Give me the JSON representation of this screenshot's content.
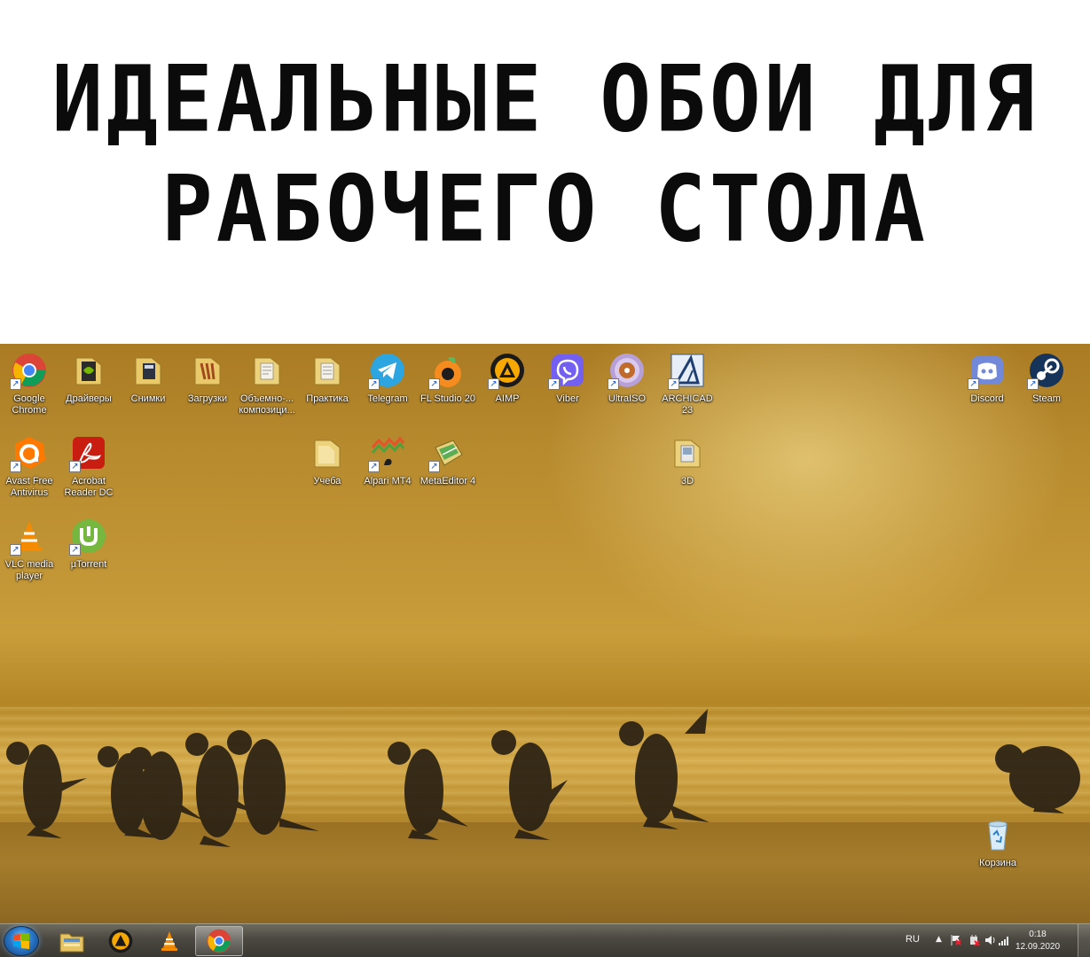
{
  "caption": {
    "line1": "ИДЕАЛЬНЫЕ ОБОИ ДЛЯ",
    "line2": "РАБОЧЕГО СТОЛА"
  },
  "desktop_icons": [
    {
      "label": "Google Chrome",
      "icon": "chrome-icon"
    },
    {
      "label": "Драйверы",
      "icon": "folder-icon"
    },
    {
      "label": "Снимки",
      "icon": "folder-icon"
    },
    {
      "label": "Загрузки",
      "icon": "folder-icon"
    },
    {
      "label": "Объемно-... композици...",
      "icon": "folder-icon"
    },
    {
      "label": "Практика",
      "icon": "folder-icon"
    },
    {
      "label": "Telegram",
      "icon": "telegram-icon"
    },
    {
      "label": "FL Studio 20",
      "icon": "fl-studio-icon"
    },
    {
      "label": "AIMP",
      "icon": "aimp-icon"
    },
    {
      "label": "Viber",
      "icon": "viber-icon"
    },
    {
      "label": "UltraISO",
      "icon": "ultraiso-icon"
    },
    {
      "label": "ARCHICAD 23",
      "icon": "archicad-icon"
    },
    {
      "label": "Discord",
      "icon": "discord-icon"
    },
    {
      "label": "Steam",
      "icon": "steam-icon"
    },
    {
      "label": "Avast Free Antivirus",
      "icon": "avast-icon"
    },
    {
      "label": "Acrobat Reader DC",
      "icon": "acrobat-icon"
    },
    {
      "label": "Учеба",
      "icon": "folder-icon"
    },
    {
      "label": "Alpari MT4",
      "icon": "alpari-icon"
    },
    {
      "label": "MetaEditor 4",
      "icon": "metaeditor-icon"
    },
    {
      "label": "3D",
      "icon": "folder-icon"
    },
    {
      "label": "VLC media player",
      "icon": "vlc-icon"
    },
    {
      "label": "µTorrent",
      "icon": "utorrent-icon"
    },
    {
      "label": "Корзина",
      "icon": "recycle-bin-icon"
    }
  ],
  "taskbar": {
    "pinned": [
      {
        "name": "explorer",
        "icon": "explorer-icon"
      },
      {
        "name": "aimp",
        "icon": "aimp-icon"
      },
      {
        "name": "vlc",
        "icon": "vlc-icon"
      },
      {
        "name": "chrome",
        "icon": "chrome-icon",
        "active": true
      }
    ],
    "tray": {
      "language": "RU",
      "time": "0:18",
      "date": "12.09.2020"
    }
  },
  "colors": {
    "wallpaper_gold": "#c99d3a",
    "taskbar": "#4b4841",
    "caption_text": "#0b0b0b"
  }
}
